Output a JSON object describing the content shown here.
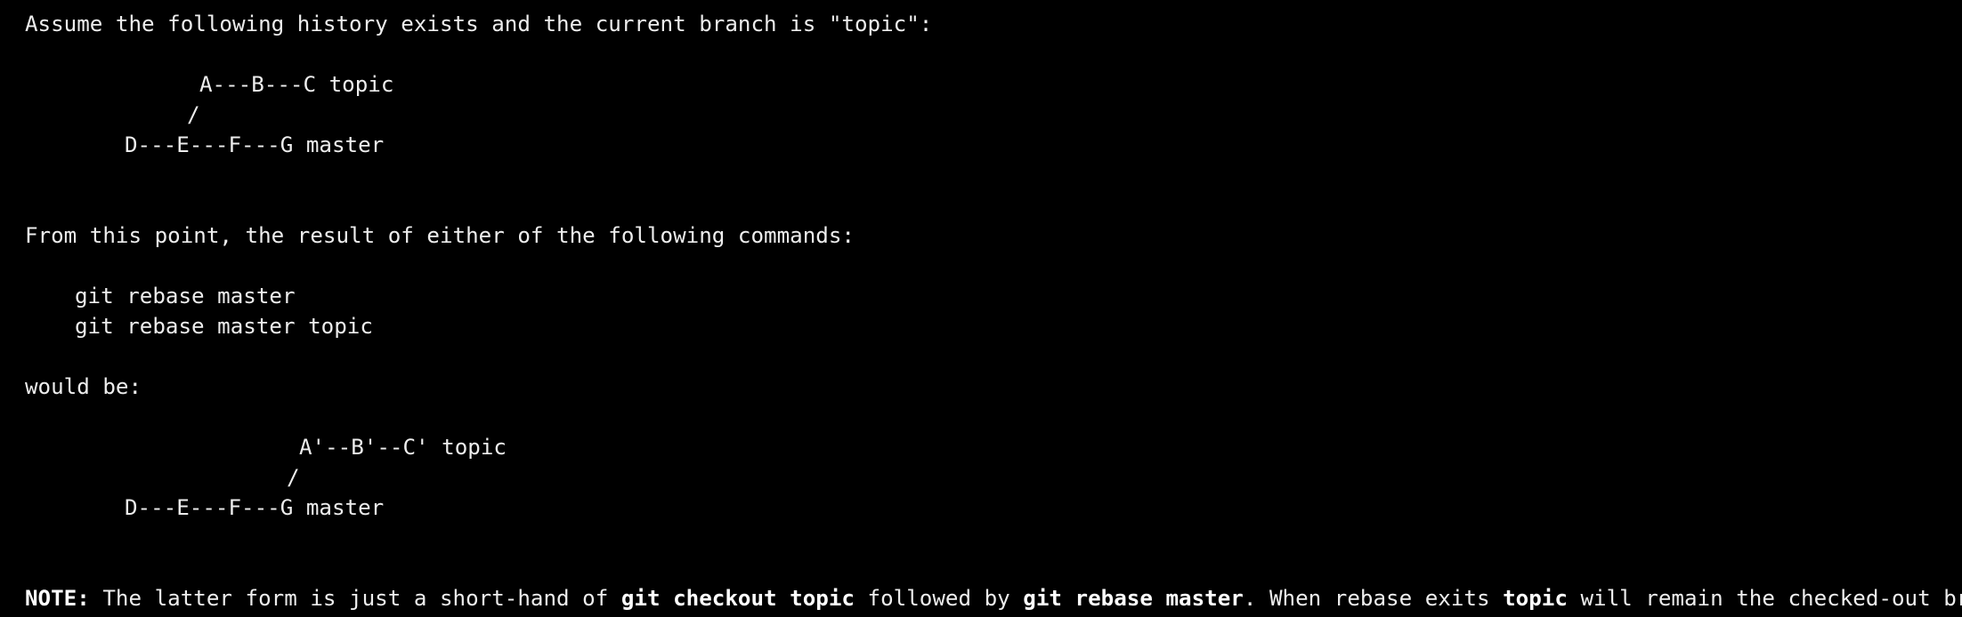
{
  "colors": {
    "background": "#000000",
    "text": "#ededed",
    "bold_text": "#ffffff"
  },
  "intro": "Assume the following history exists and the current branch is \"topic\":",
  "diagram1": {
    "line1": "A---B---C topic",
    "line2": "/",
    "line3": "D---E---F---G master"
  },
  "para2": "From this point, the result of either of the following commands:",
  "commands": {
    "cmd1": "git rebase master",
    "cmd2": "git rebase master topic"
  },
  "would_be": "would be:",
  "diagram2": {
    "line1": "A'--B'--C' topic",
    "line2": "/",
    "line3": "D---E---F---G master"
  },
  "note": {
    "label": "NOTE:",
    "t1": " The latter form is just a short-hand of ",
    "c1": "git checkout topic",
    "t2": " followed by ",
    "c2": "git rebase master",
    "t3": ". When rebase exits ",
    "c3": "topic",
    "t4": " will remain the checked-out branch."
  }
}
